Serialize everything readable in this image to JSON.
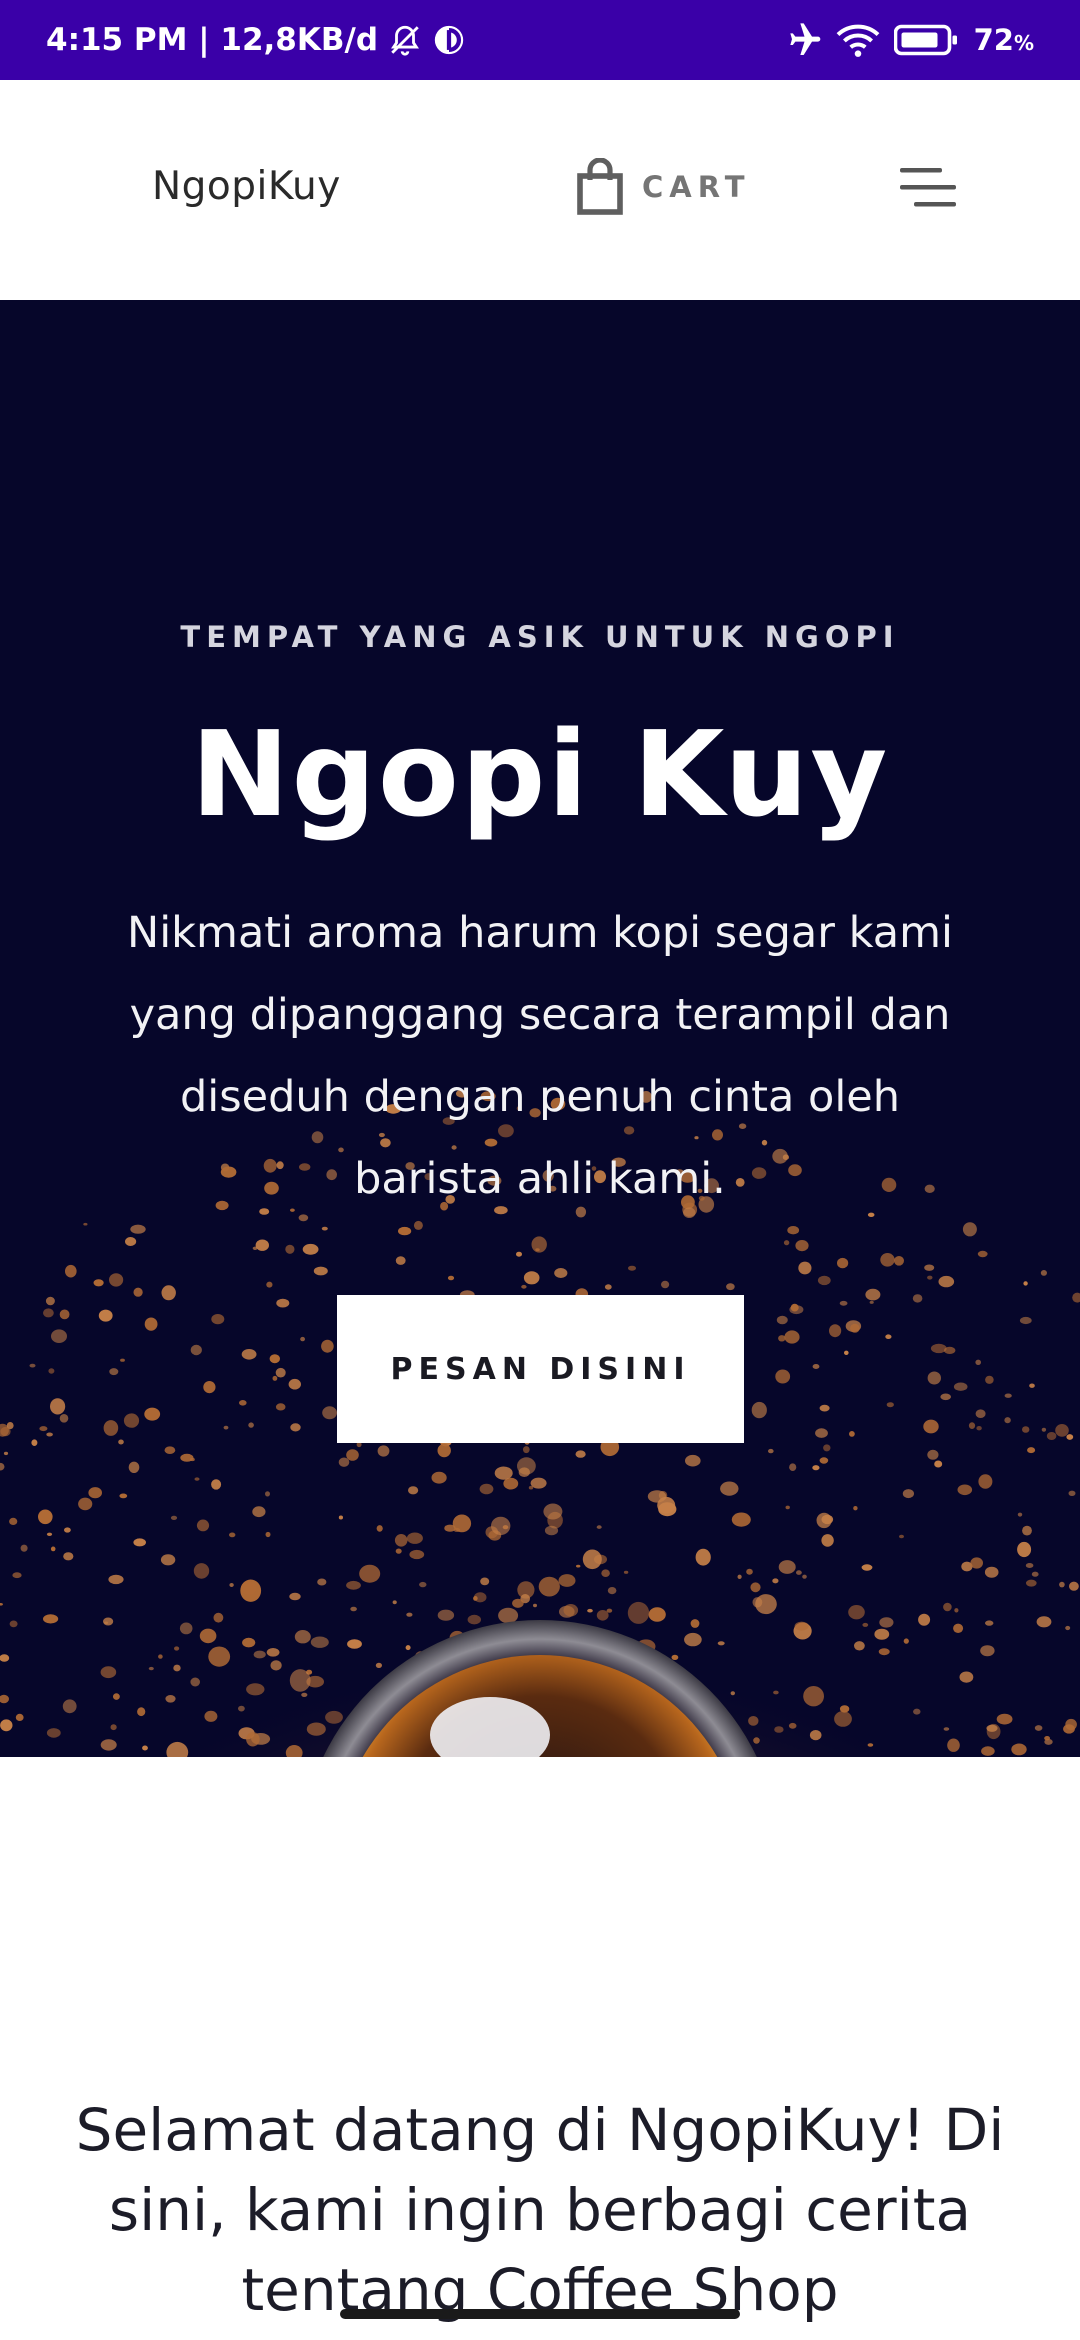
{
  "status_bar": {
    "time_info": "4:15 PM | 12,8KB/d",
    "battery": "72",
    "battery_unit": "%",
    "icons": [
      "bell-off-icon",
      "data-saver-icon",
      "airplane-icon",
      "wifi-icon",
      "battery-icon"
    ]
  },
  "navbar": {
    "brand": "NgopiKuy",
    "cart_label": "CART",
    "icons": [
      "shopping-bag-icon",
      "menu-icon"
    ]
  },
  "hero": {
    "eyebrow": "TEMPAT YANG ASIK UNTUK NGOPI",
    "title": "Ngopi Kuy",
    "description": "Nikmati aroma harum kopi segar kami yang dipanggang secara terampil dan diseduh dengan penuh cinta oleh barista ahli kami.",
    "cta_label": "PESAN DISINI",
    "background_color": "#06062a"
  },
  "welcome": {
    "text": "Selamat datang di NgopiKuy! Di sini, kami ingin berbagi cerita tentang Coffee Shop"
  },
  "colors": {
    "status_bar": "#3a00a8",
    "coffee_grounds": "#b06a35",
    "text_dark": "#1c1c28"
  }
}
